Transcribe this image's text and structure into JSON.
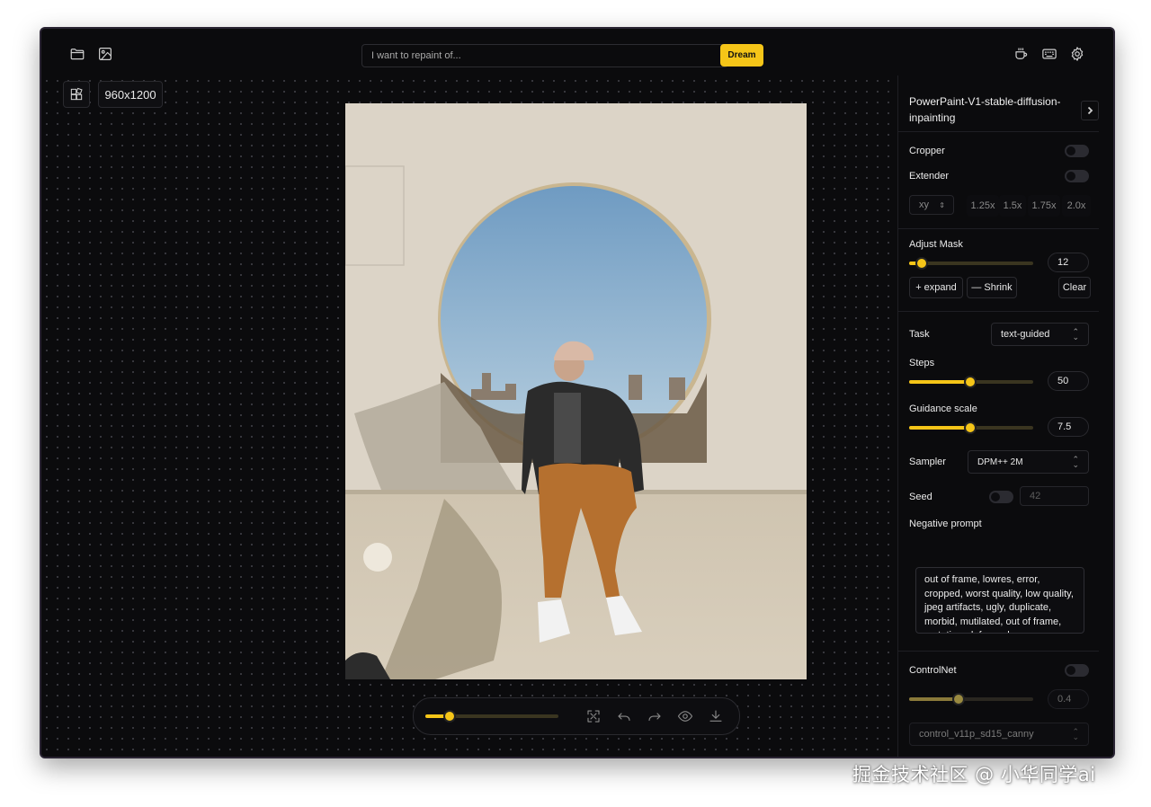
{
  "topbar": {
    "prompt_placeholder": "I want to repaint of...",
    "dream_label": "Dream",
    "left_icons": [
      "folder-icon",
      "image-icon"
    ],
    "right_icons": [
      "coffee-icon",
      "keyboard-icon",
      "gear-icon"
    ]
  },
  "canvas": {
    "dims_label": "960x1200",
    "zoom_slider_value": 0.18
  },
  "side_panel": {
    "model_name": "PowerPaint-V1-stable-diffusion-inpainting",
    "cropper_label": "Cropper",
    "cropper_on": false,
    "extender_label": "Extender",
    "extender_on": false,
    "extender_direction": "xy",
    "extender_scales": [
      "1.25x",
      "1.5x",
      "1.75x",
      "2.0x"
    ],
    "adjust_mask_label": "Adjust Mask",
    "adjust_mask_value": "12",
    "adjust_mask_fraction": 0.1,
    "expand_label": "+ expand",
    "shrink_label": "— Shrink",
    "clear_label": "Clear",
    "task_label": "Task",
    "task_value": "text-guided",
    "steps_label": "Steps",
    "steps_value": "50",
    "steps_fraction": 0.49,
    "guidance_label": "Guidance scale",
    "guidance_value": "7.5",
    "guidance_fraction": 0.49,
    "sampler_label": "Sampler",
    "sampler_value": "DPM++ 2M",
    "seed_label": "Seed",
    "seed_on": false,
    "seed_value": "42",
    "negative_prompt_label": "Negative prompt",
    "negative_prompt_value": "out of frame, lowres, error, cropped, worst quality, low quality, jpeg artifacts, ugly, duplicate, morbid, mutilated, out of frame, mutation, deformed",
    "controlnet_label": "ControlNet",
    "controlnet_on": false,
    "controlnet_weight": "0.4",
    "controlnet_fraction": 0.4,
    "controlnet_model": "control_v11p_sd15_canny"
  },
  "watermark": "掘金技术社区 @ 小华同学ai",
  "colors": {
    "accent": "#f5c518",
    "background": "#0b0b0d",
    "border": "#2a2a2f"
  }
}
